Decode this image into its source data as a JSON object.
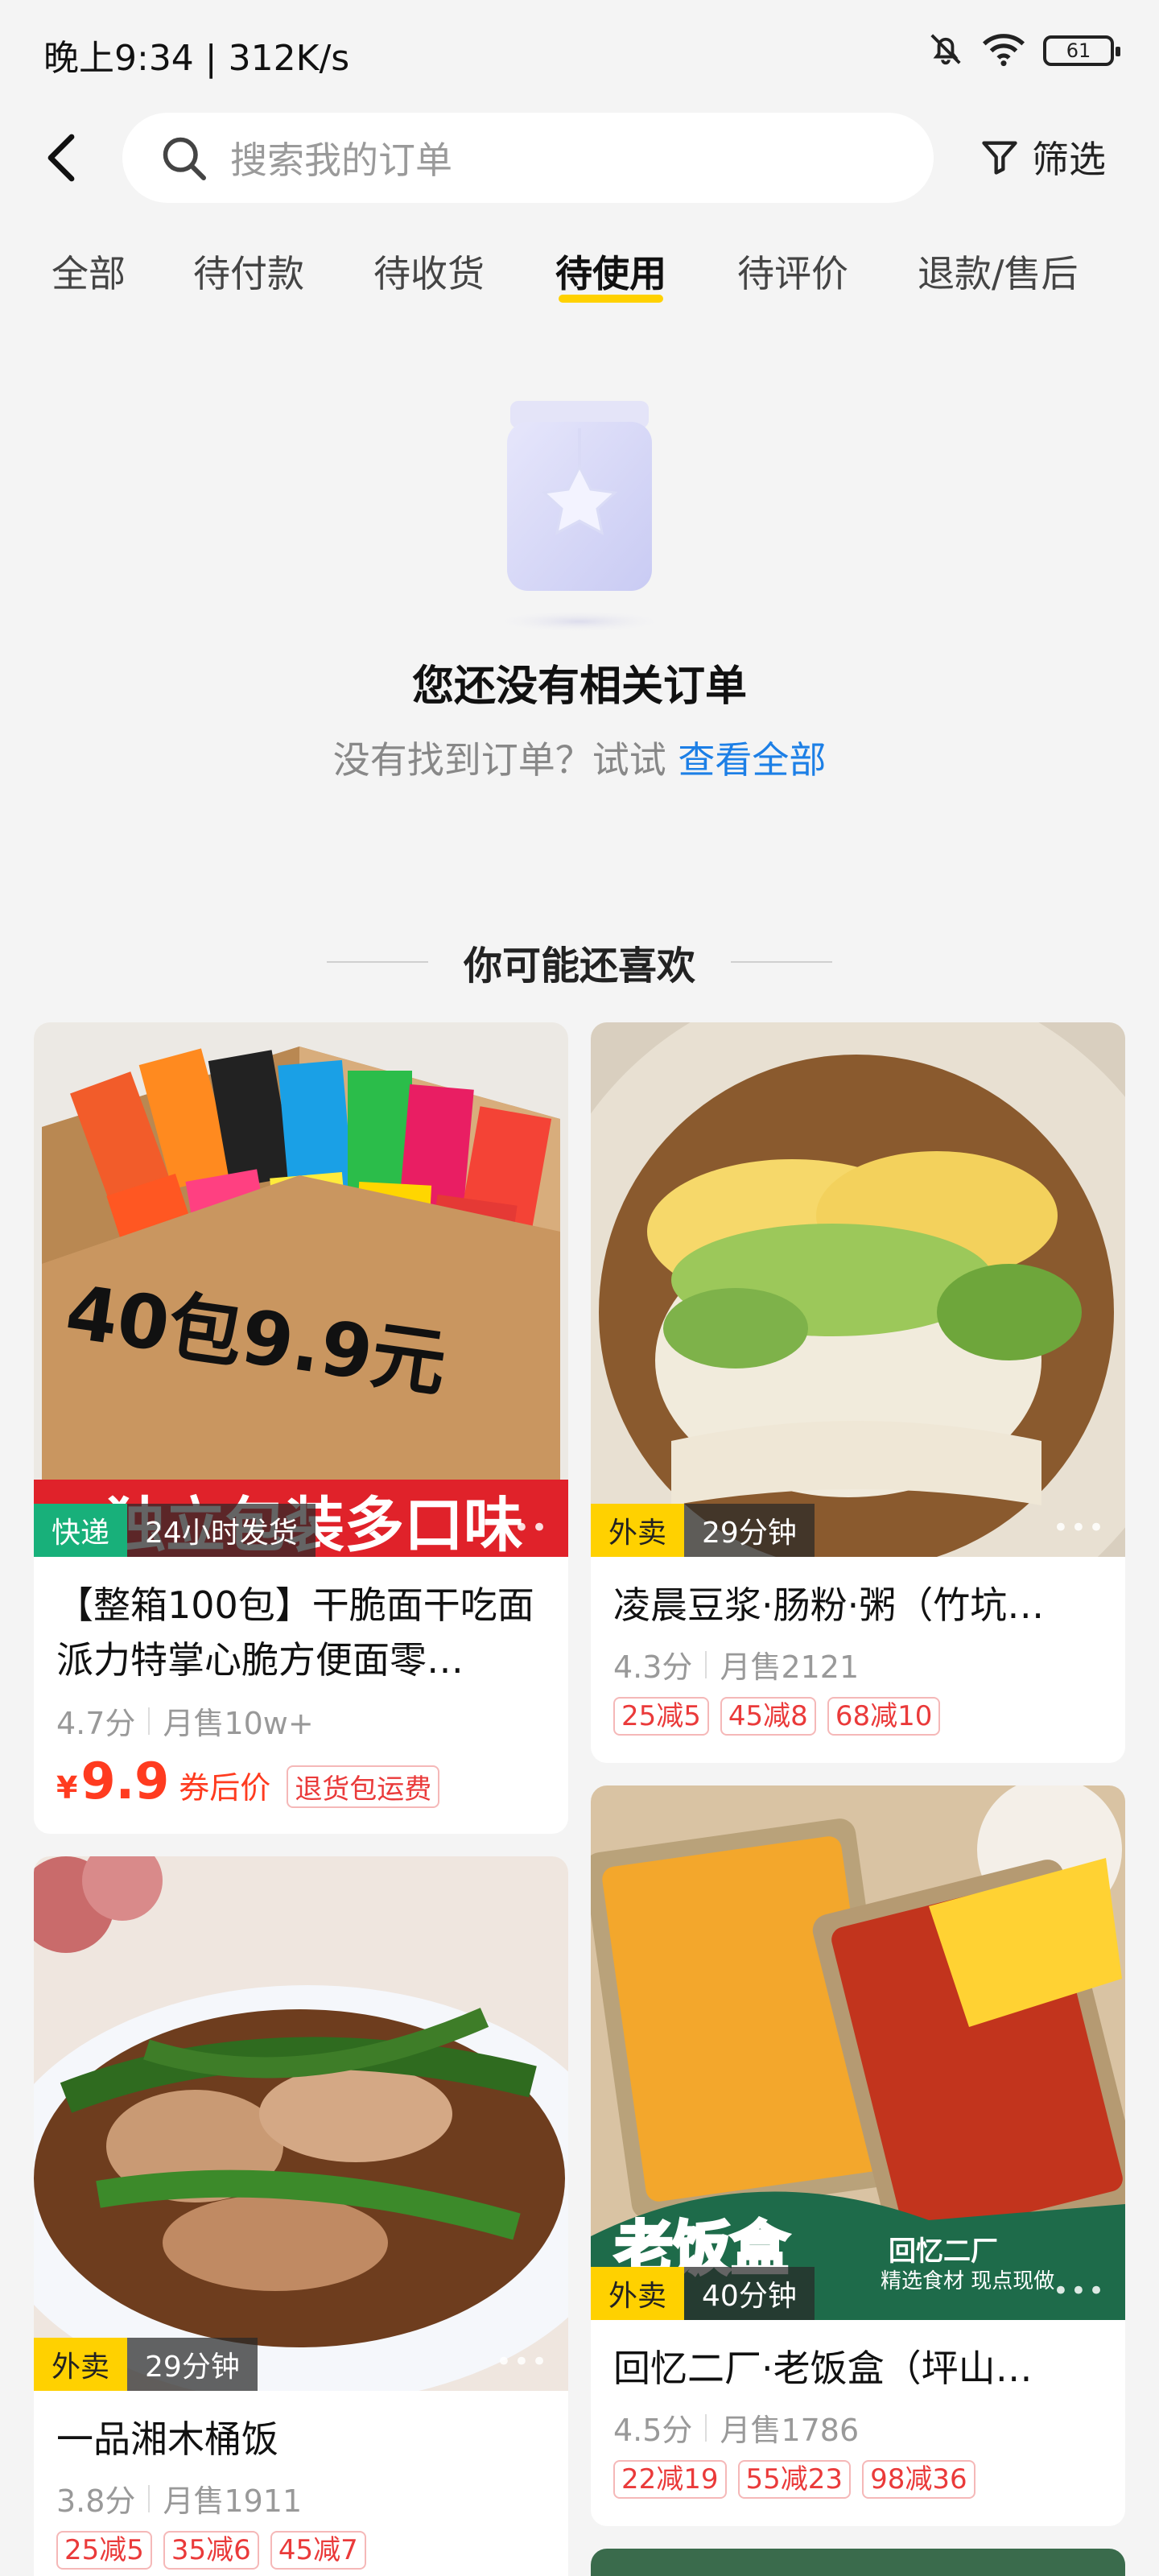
{
  "status_bar": {
    "time": "晚上9:34 | 312K/s",
    "battery": "61"
  },
  "header": {
    "search_placeholder": "搜索我的订单",
    "filter_label": "筛选"
  },
  "tabs": [
    {
      "label": "全部"
    },
    {
      "label": "待付款"
    },
    {
      "label": "待收货"
    },
    {
      "label": "待使用",
      "active": true
    },
    {
      "label": "待评价"
    },
    {
      "label": "退款/售后"
    }
  ],
  "empty_state": {
    "title": "您还没有相关订单",
    "subtitle": "没有找到订单？试试",
    "link": "查看全部"
  },
  "recommend": {
    "title": "你可能还喜欢",
    "items": [
      {
        "title": "【整箱100包】干脆面干吃面派力特掌心脆方便面零…",
        "badge_primary": "快递",
        "badge_secondary": "24小时发货",
        "image_text": "40包9.9元",
        "image_banner": "独立包装多口味",
        "rating": "4.7分",
        "sales": "月售10w+",
        "price_symbol": "¥",
        "price": "9.9",
        "price_label": "券后价",
        "tag": "退货包运费"
      },
      {
        "title": "凌晨豆浆·肠粉·粥（竹坑…",
        "badge_primary": "外卖",
        "badge_secondary": "29分钟",
        "rating": "4.3分",
        "sales": "月售2121",
        "coupons": [
          "25减5",
          "45减8",
          "68减10"
        ]
      },
      {
        "title": "一品湘木桶饭",
        "badge_primary": "外卖",
        "badge_secondary": "29分钟",
        "rating": "3.8分",
        "sales": "月售1911",
        "coupons": [
          "25减5",
          "35减6",
          "45减7"
        ]
      },
      {
        "title": "回忆二厂·老饭盒（坪山…",
        "badge_primary": "外卖",
        "badge_secondary": "40分钟",
        "image_text": "老饭盒",
        "image_brand": "回忆二厂",
        "image_slogan": "精选食材 现点现做",
        "rating": "4.5分",
        "sales": "月售1786",
        "coupons": [
          "22减19",
          "55减23",
          "98减36"
        ]
      }
    ]
  },
  "colors": {
    "accent_yellow": "#ffd100",
    "link_blue": "#1c7fe6",
    "price_red": "#ff3b1f",
    "express_green": "#18b07a"
  }
}
